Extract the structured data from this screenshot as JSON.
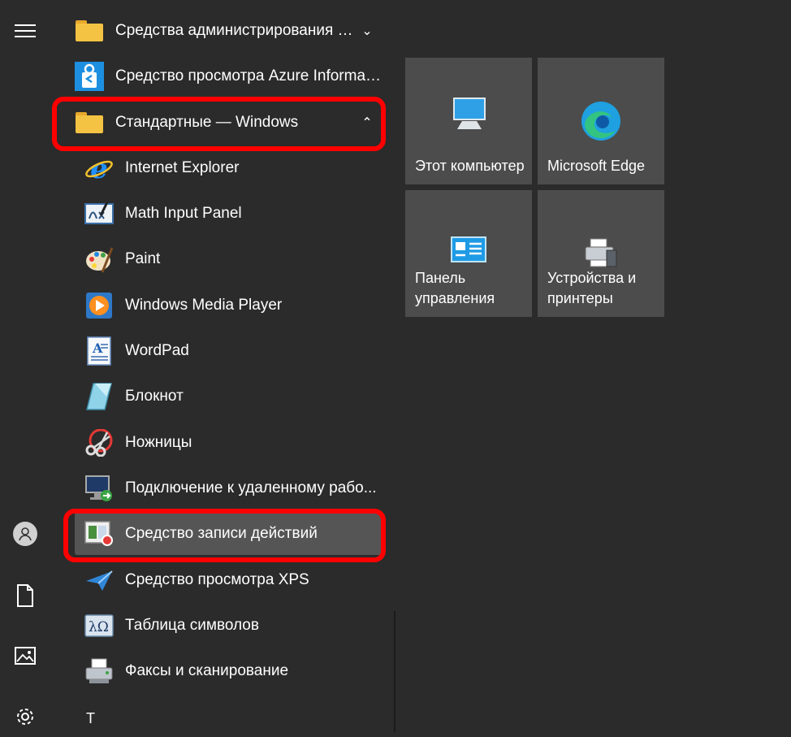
{
  "rail": {
    "menu_icon": "hamburger-icon",
    "user_icon": "user-icon",
    "documents_icon": "document-icon",
    "pictures_icon": "pictures-icon",
    "settings_icon": "settings-icon"
  },
  "apps": {
    "admin_tools": "Средства администрирования W...",
    "azure_viewer": "Средство просмотра Azure Informati...",
    "accessories": "Стандартные — Windows",
    "ie": "Internet Explorer",
    "math": "Math Input Panel",
    "paint": "Paint",
    "wmp": "Windows Media Player",
    "wordpad": "WordPad",
    "notepad": "Блокнот",
    "snipping": "Ножницы",
    "rdp": "Подключение к удаленному рабо...",
    "steps": "Средство записи действий",
    "xps": "Средство просмотра XPS",
    "charmap": "Таблица символов",
    "fax": "Факсы и сканирование",
    "section_letter": "Т"
  },
  "tiles": {
    "computer": "Этот компьютер",
    "edge": "Microsoft Edge",
    "control": "Панель управления",
    "devices": "Устройства и принтеры"
  },
  "colors": {
    "background": "#2b2b2b",
    "tile": "#4c4c4c",
    "highlight": "#ff0000",
    "folder": "#f4c343"
  }
}
